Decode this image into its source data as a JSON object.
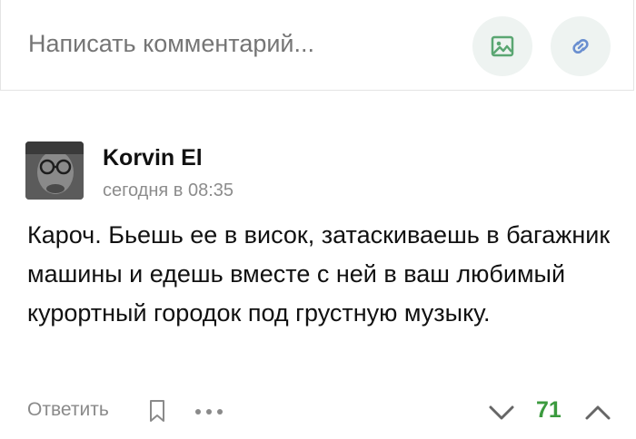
{
  "composer": {
    "placeholder": "Написать комментарий...",
    "image_button_icon": "image-icon",
    "link_button_icon": "link-icon",
    "icon_bg": "#eef3f1",
    "icon_color": "#5aa672"
  },
  "comment": {
    "author": "Korvin El",
    "timestamp": "сегодня в 08:35",
    "text": "Кароч. Бьешь ее в висок, затаскиваешь в багажник машины и едешь вместе с ней в ваш любимый курортный городок под грустную музыку.",
    "actions": {
      "reply_label": "Ответить",
      "bookmark_icon": "bookmark-icon",
      "more_icon": "more-dots-icon"
    },
    "rating": "71",
    "rating_color": "#3b9a3e"
  }
}
